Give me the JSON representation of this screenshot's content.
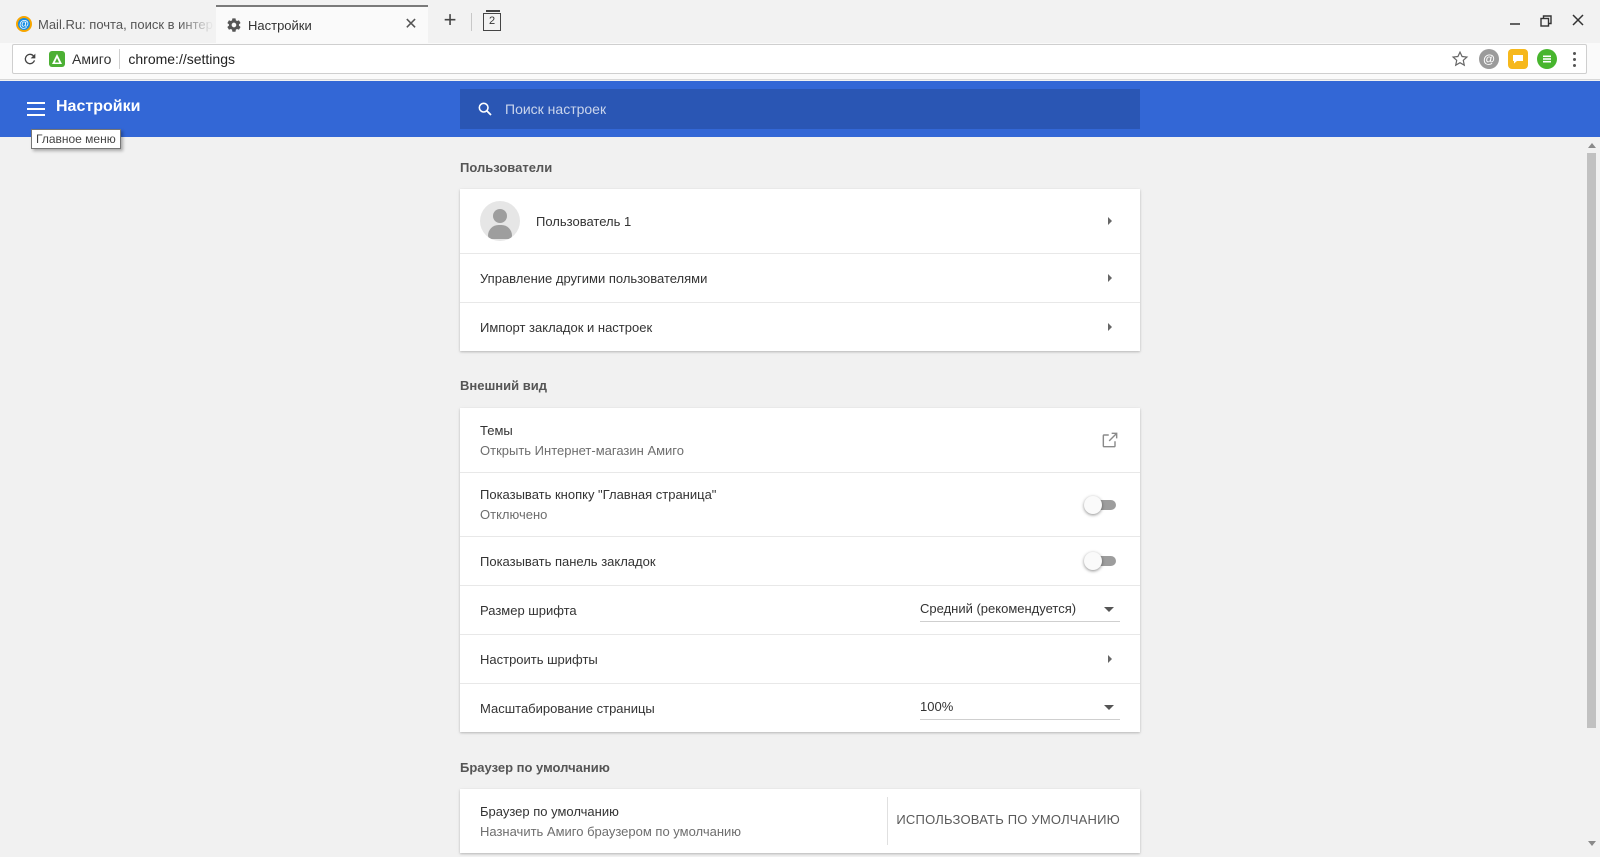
{
  "tabs": [
    {
      "title": "Mail.Ru: почта, поиск в интернете",
      "favicon": "mailru-icon"
    },
    {
      "title": "Настройки",
      "favicon": "gear-icon"
    }
  ],
  "tab_count": "2",
  "omnibox": {
    "site_name": "Амиго",
    "url": "chrome://settings"
  },
  "header": {
    "title": "Настройки",
    "search_placeholder": "Поиск настроек",
    "accent_color": "#3367d6"
  },
  "tooltip": "Главное меню",
  "sections": {
    "users": {
      "title": "Пользователи",
      "profile_name": "Пользователь 1",
      "manage_label": "Управление другими пользователями",
      "import_label": "Импорт закладок и настроек"
    },
    "appearance": {
      "title": "Внешний вид",
      "themes_label": "Темы",
      "themes_sub": "Открыть Интернет-магазин Амиго",
      "home_button_label": "Показывать кнопку \"Главная страница\"",
      "home_button_sub": "Отключено",
      "home_button_on": false,
      "bookmarks_bar_label": "Показывать панель закладок",
      "bookmarks_bar_on": false,
      "font_size_label": "Размер шрифта",
      "font_size_value": "Средний (рекомендуется)",
      "customize_fonts_label": "Настроить шрифты",
      "page_zoom_label": "Масштабирование страницы",
      "page_zoom_value": "100%"
    },
    "default_browser": {
      "title": "Браузер по умолчанию",
      "label": "Браузер по умолчанию",
      "sub": "Назначить Амиго браузером по умолчанию",
      "button": "ИСПОЛЬЗОВАТЬ ПО УМОЛЧАНИЮ"
    }
  }
}
